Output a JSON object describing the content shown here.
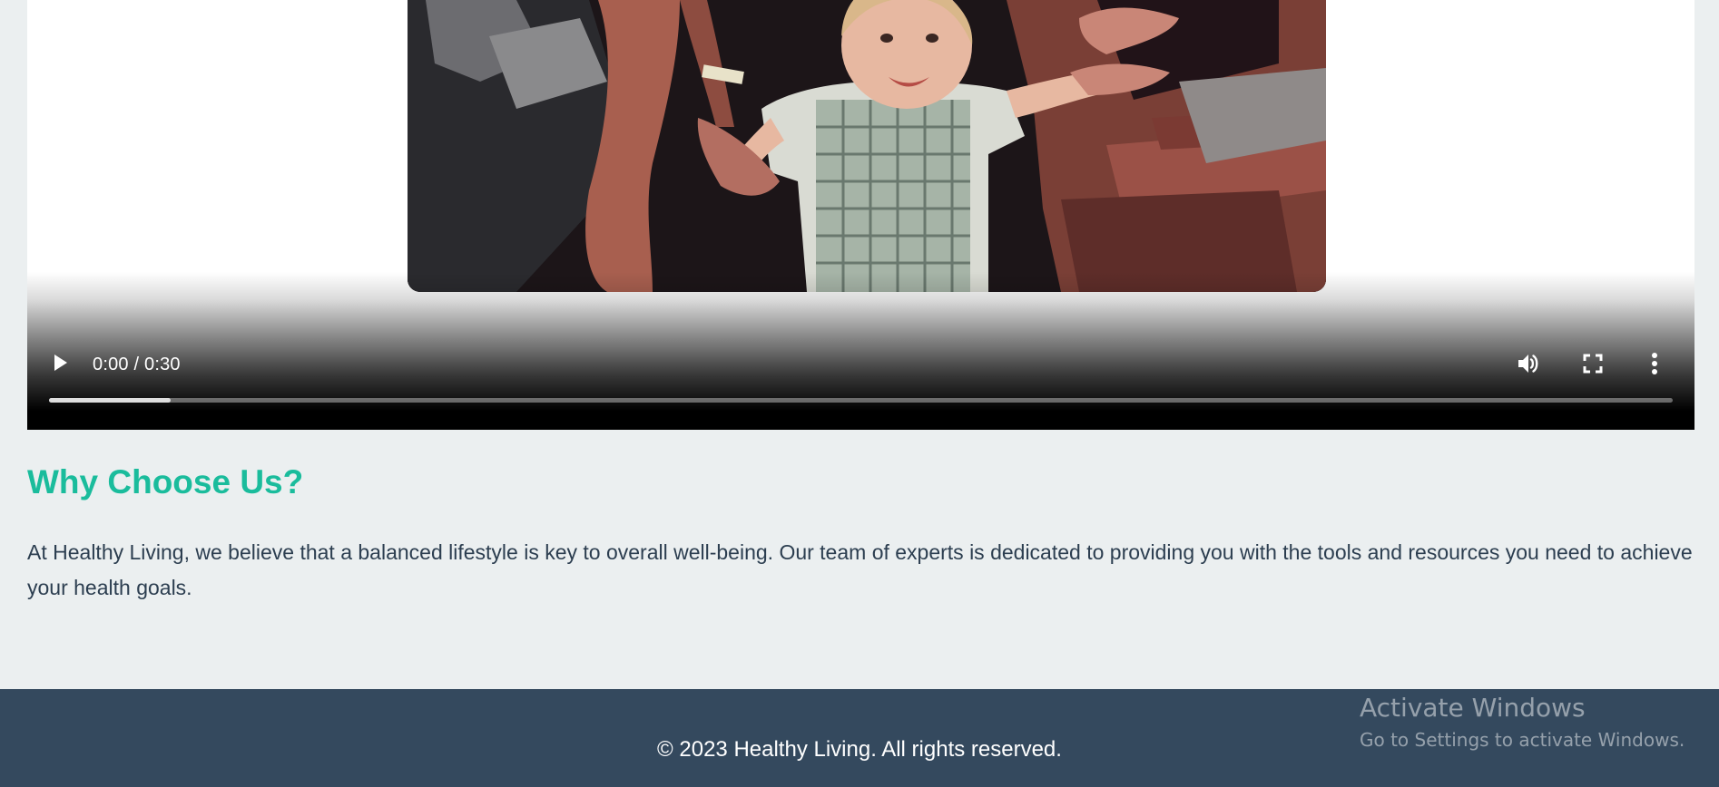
{
  "video": {
    "time_display": "0:00 / 0:30",
    "played_fraction": 0.0,
    "buffered_fraction": 0.075,
    "play_icon": "play-icon",
    "volume_icon": "volume-icon",
    "fullscreen_icon": "fullscreen-icon",
    "more_icon": "more-options-icon"
  },
  "section": {
    "title": "Why Choose Us?",
    "text": "At Healthy Living, we believe that a balanced lifestyle is key to overall well-being. Our team of experts is dedicated to providing you with the tools and resources you need to achieve your health goals."
  },
  "footer": {
    "text": "© 2023 Healthy Living. All rights reserved."
  },
  "watermark": {
    "title": "Activate Windows",
    "subtitle": "Go to Settings to activate Windows."
  },
  "colors": {
    "page_bg": "#ebeff0",
    "accent": "#1abc9c",
    "body_text": "#2c3e50",
    "footer_bg": "#34495e"
  }
}
